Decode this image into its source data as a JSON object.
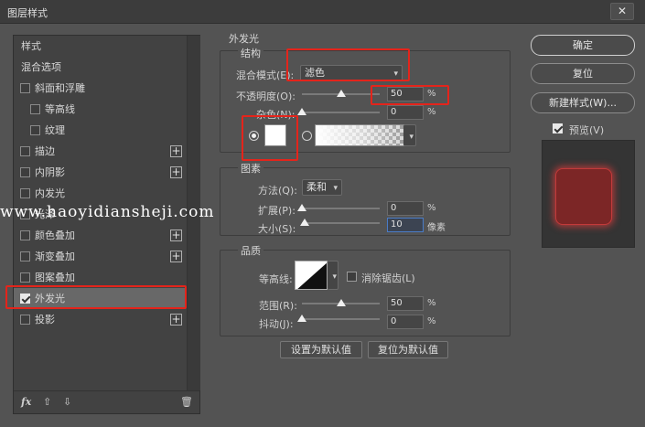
{
  "window": {
    "title": "图层样式",
    "close_glyph": "✕"
  },
  "left_panel": {
    "styles_header": "样式",
    "blending_options": "混合选项",
    "items": [
      {
        "label": "斜面和浮雕",
        "checked": false,
        "plus": false,
        "indent": false
      },
      {
        "label": "等高线",
        "checked": false,
        "plus": false,
        "indent": true
      },
      {
        "label": "纹理",
        "checked": false,
        "plus": false,
        "indent": true
      },
      {
        "label": "描边",
        "checked": false,
        "plus": true,
        "indent": false
      },
      {
        "label": "内阴影",
        "checked": false,
        "plus": true,
        "indent": false
      },
      {
        "label": "内发光",
        "checked": false,
        "plus": false,
        "indent": false
      },
      {
        "label": "光泽",
        "checked": false,
        "plus": false,
        "indent": false
      },
      {
        "label": "颜色叠加",
        "checked": false,
        "plus": true,
        "indent": false
      },
      {
        "label": "渐变叠加",
        "checked": false,
        "plus": true,
        "indent": false
      },
      {
        "label": "图案叠加",
        "checked": false,
        "plus": false,
        "indent": false
      },
      {
        "label": "外发光",
        "checked": true,
        "plus": false,
        "indent": false,
        "selected": true
      },
      {
        "label": "投影",
        "checked": false,
        "plus": true,
        "indent": false
      }
    ],
    "plus_glyph": "+",
    "footer": {
      "fx": "fx",
      "up": "⇧",
      "down": "⇩",
      "trash": "🗑"
    }
  },
  "outer_glow": {
    "title": "外发光",
    "structure": {
      "title": "结构",
      "blend_mode_label": "混合模式(E):",
      "blend_mode_value": "滤色",
      "opacity_label": "不透明度(O):",
      "opacity_value": "50",
      "opacity_unit": "%",
      "noise_label": "杂色(N):",
      "noise_value": "0",
      "noise_unit": "%"
    },
    "elements": {
      "title": "图素",
      "technique_label": "方法(Q):",
      "technique_value": "柔和",
      "spread_label": "扩展(P):",
      "spread_value": "0",
      "spread_unit": "%",
      "size_label": "大小(S):",
      "size_value": "10",
      "size_unit": "像素"
    },
    "quality": {
      "title": "品质",
      "contour_label": "等高线:",
      "antialias_label": "消除锯齿(L)",
      "range_label": "范围(R):",
      "range_value": "50",
      "range_unit": "%",
      "jitter_label": "抖动(J):",
      "jitter_value": "0",
      "jitter_unit": "%"
    },
    "set_default": "设置为默认值",
    "reset_default": "复位为默认值"
  },
  "sliders": {
    "opacity": 0.5,
    "noise": 0,
    "spread": 0,
    "size": 0.04,
    "range": 0.5,
    "jitter": 0
  },
  "buttons": {
    "ok": "确定",
    "reset": "复位",
    "new_style": "新建样式(W)...",
    "preview_label": "预览(V)"
  },
  "colors": {
    "glow_color": "#ffffff",
    "preview_fill": "#7c2626",
    "highlight_red": "#e4241b"
  },
  "watermark": "www.haoyidiansheji.com"
}
